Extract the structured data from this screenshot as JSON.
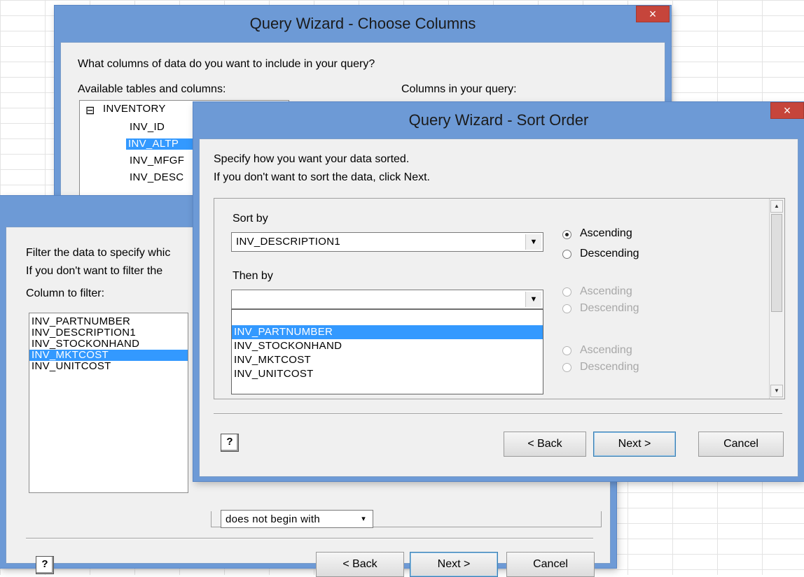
{
  "choose_columns": {
    "title": "Query Wizard - Choose Columns",
    "close": "×",
    "prompt": "What columns of data do you want to include in your query?",
    "available_label": "Available tables and columns:",
    "query_label": "Columns in your query:",
    "tree_expander": "⊟",
    "table_name": "INVENTORY",
    "tree_items": [
      "INV_ID",
      "INV_ALTP",
      "INV_MFGF",
      "INV_DESC"
    ]
  },
  "filter_data": {
    "line1": "Filter the data to specify whic",
    "line2": "If you don't want to filter the",
    "column_label": "Column to filter:",
    "columns": [
      "INV_PARTNUMBER",
      "INV_DESCRIPTION1",
      "INV_STOCKONHAND",
      "INV_MKTCOST",
      "INV_UNITCOST"
    ],
    "condition_value": "does not begin with",
    "help": "?",
    "back": "< Back",
    "next": "Next >",
    "cancel": "Cancel"
  },
  "sort_order": {
    "title": "Query Wizard - Sort Order",
    "close": "×",
    "line1": "Specify how you want your data sorted.",
    "line2": "If you don't want to sort the data, click Next.",
    "sort_by_label": "Sort by",
    "sort_by_value": "INV_DESCRIPTION1",
    "then_by_label": "Then by",
    "then_by_value": "",
    "dropdown_items": [
      "",
      "INV_PARTNUMBER",
      "INV_STOCKONHAND",
      "INV_MKTCOST",
      "INV_UNITCOST"
    ],
    "ascending": "Ascending",
    "descending": "Descending",
    "help": "?",
    "back": "< Back",
    "next": "Next >",
    "cancel": "Cancel"
  },
  "colors": {
    "title_bar": "#6d9ad6",
    "close_red": "#c6453b",
    "selection": "#3399ff",
    "dialog_face": "#f0f0f0"
  }
}
